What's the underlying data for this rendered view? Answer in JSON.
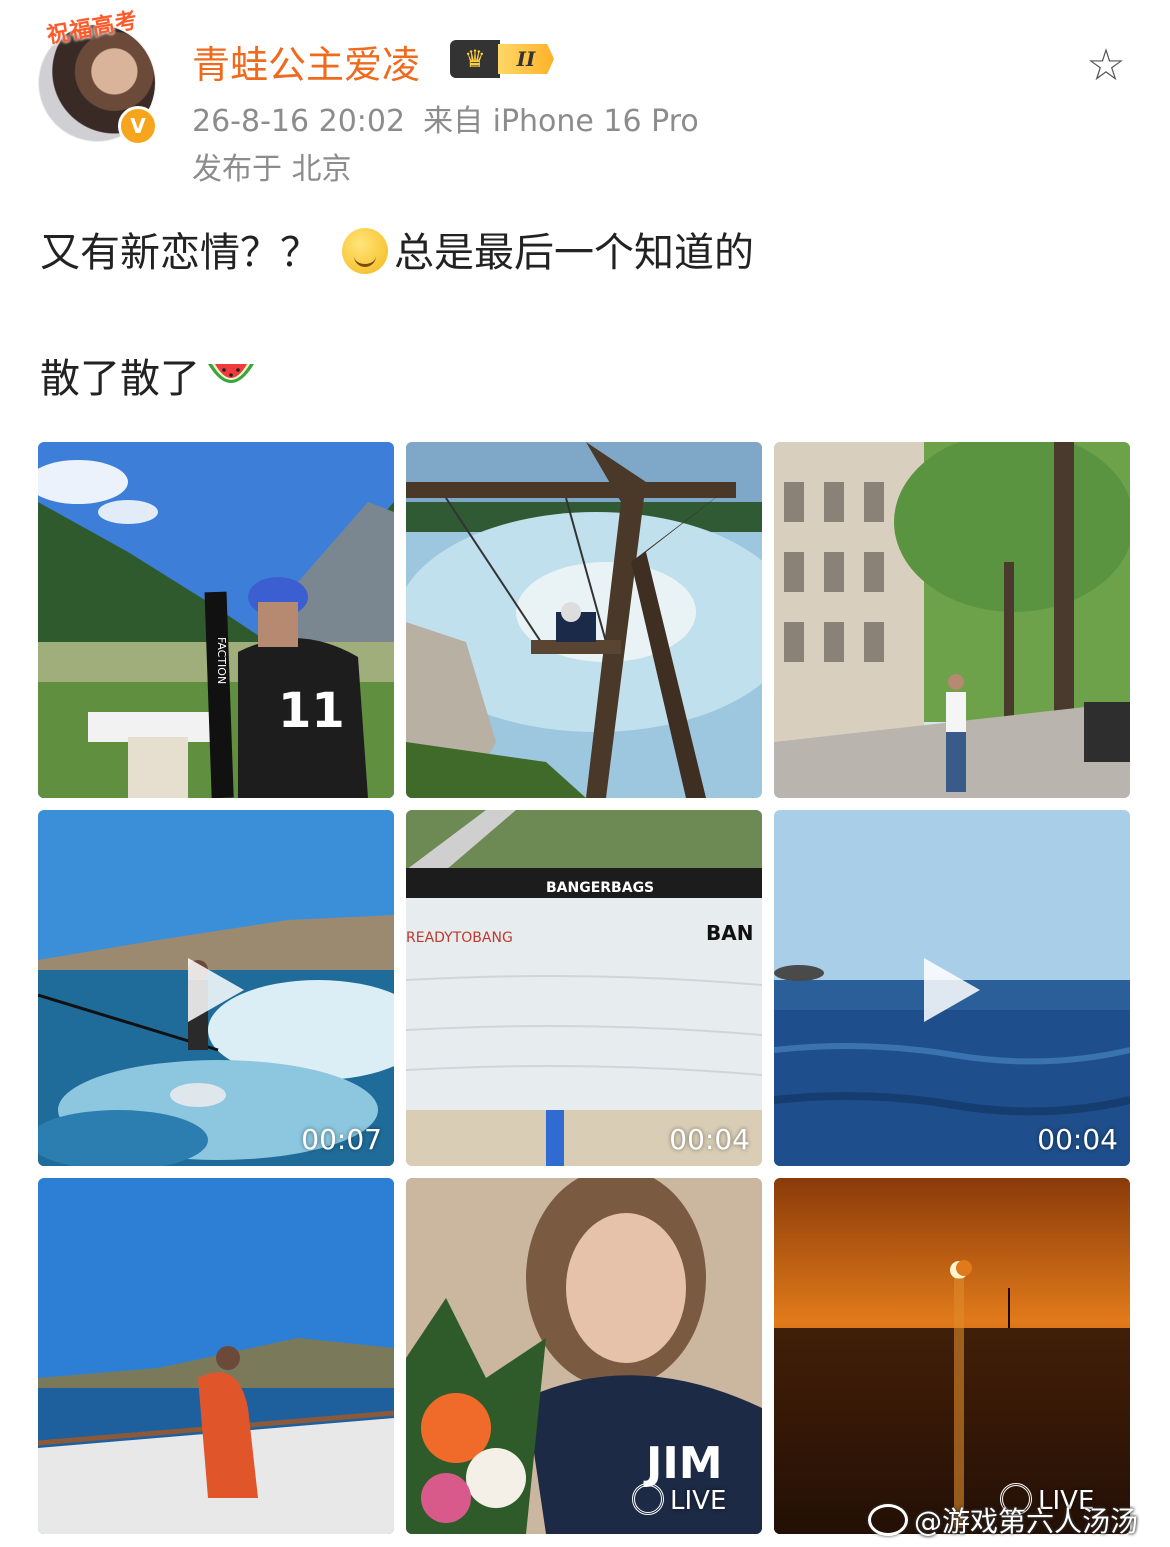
{
  "header": {
    "avatar_banner": "祝福高考",
    "verified_mark": "V",
    "username": "青蛙公主爱凌",
    "vip_level": "II",
    "timestamp": "26-8-16 20:02",
    "source": "来自 iPhone 16 Pro",
    "location": "发布于 北京"
  },
  "post": {
    "line1_a": "又有新恋情？？",
    "line1_b": "总是最后一个知道的",
    "line2": "散了散了"
  },
  "media": [
    {
      "label": "photo-mountain-ski",
      "type": "photo"
    },
    {
      "label": "photo-lake-swing",
      "type": "photo"
    },
    {
      "label": "photo-street",
      "type": "photo"
    },
    {
      "label": "video-wakesurf",
      "type": "video",
      "duration": "00:07"
    },
    {
      "label": "video-bag-jump",
      "type": "video",
      "duration": "00:04"
    },
    {
      "label": "video-sea",
      "type": "video",
      "duration": "00:04"
    },
    {
      "label": "photo-boat",
      "type": "photo"
    },
    {
      "label": "live-selfie",
      "type": "live",
      "badge": "LIVE"
    },
    {
      "label": "live-sunset",
      "type": "live",
      "badge": "LIVE"
    }
  ],
  "tile_texts": {
    "bag_banner": "BANGERBAGS",
    "bag_text": "READYTOBANG",
    "bag_side": "BAN",
    "ski_brand": "FACTION",
    "jersey_number": "11",
    "shirt_text": "JIM"
  },
  "watermark": "@游戏第六人汤汤",
  "colors": {
    "username": "#f06a1e",
    "meta": "#8c8c8c",
    "badge_gold": "#ffb22a"
  }
}
